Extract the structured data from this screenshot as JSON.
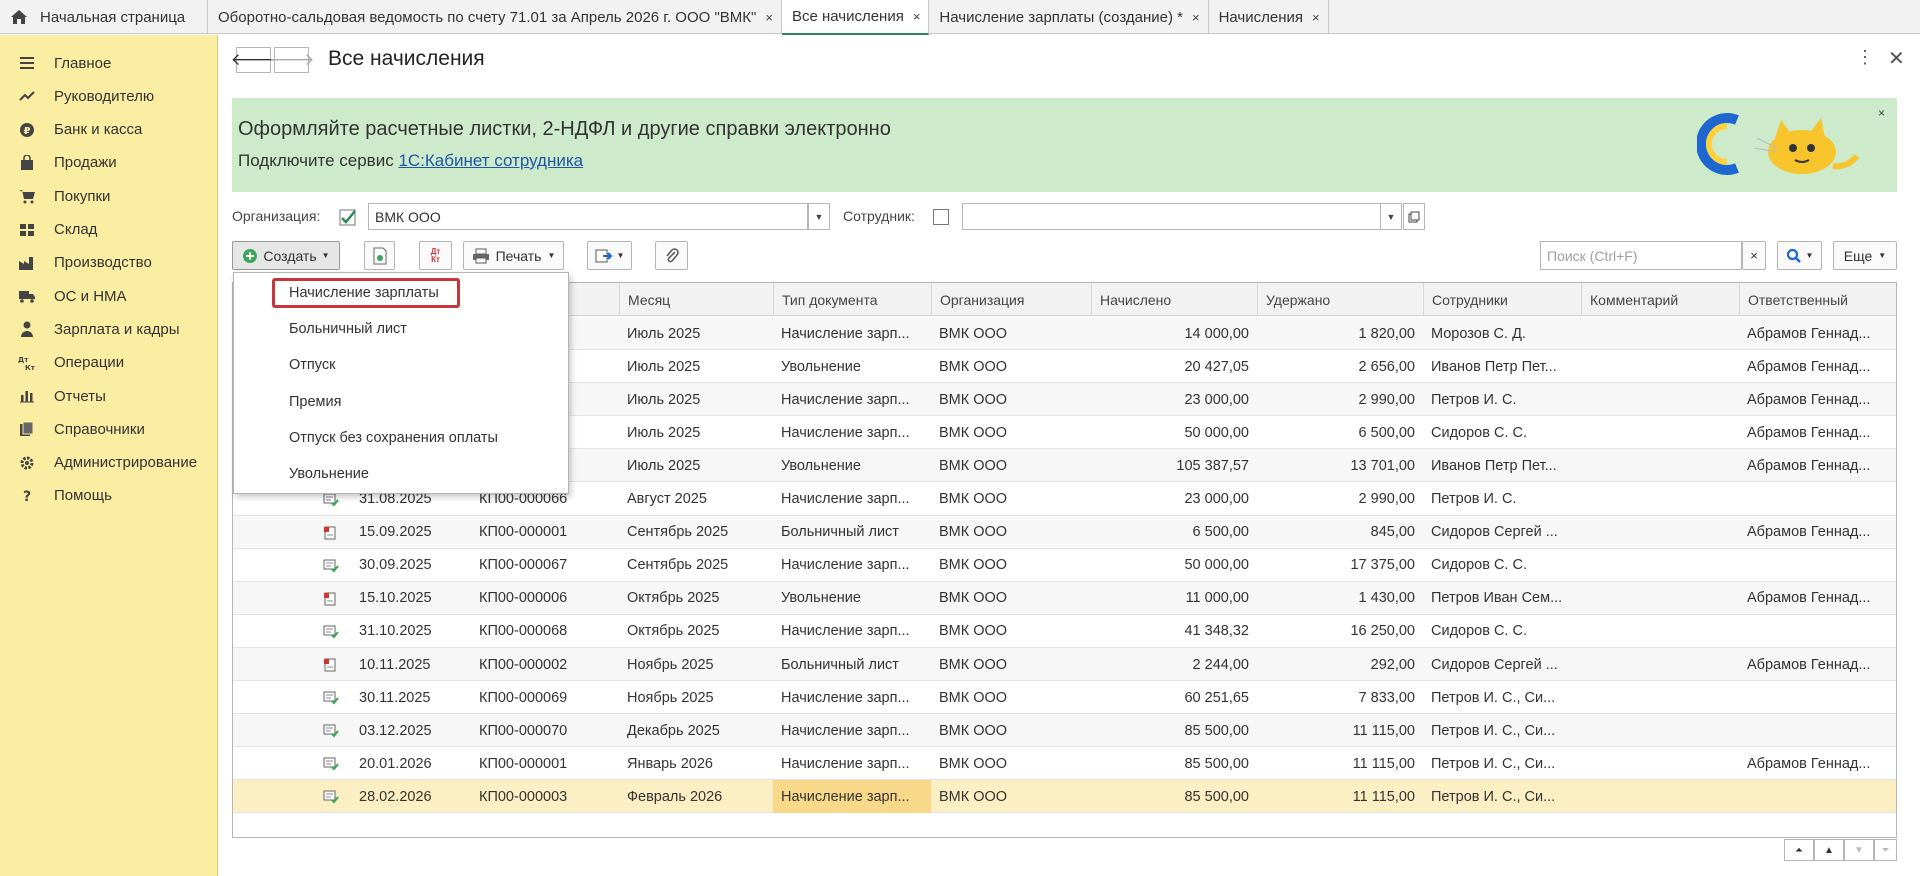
{
  "tabs": {
    "home": "Начальная страница",
    "items": [
      {
        "label": "Оборотно-сальдовая ведомость по счету 71.01 за Апрель 2026 г. ООО \"ВМК\""
      },
      {
        "label": "Все начисления"
      },
      {
        "label": "Начисление зарплаты (создание) *"
      },
      {
        "label": "Начисления"
      }
    ],
    "close_glyph": "×"
  },
  "sidebar": {
    "items": [
      {
        "label": "Главное",
        "icon": "menu-icon"
      },
      {
        "label": "Руководителю",
        "icon": "trend-icon"
      },
      {
        "label": "Банк и касса",
        "icon": "ruble-coin-icon"
      },
      {
        "label": "Продажи",
        "icon": "shopping-bag-icon"
      },
      {
        "label": "Покупки",
        "icon": "cart-icon"
      },
      {
        "label": "Склад",
        "icon": "warehouse-icon"
      },
      {
        "label": "Производство",
        "icon": "factory-icon"
      },
      {
        "label": "ОС и НМА",
        "icon": "truck-icon"
      },
      {
        "label": "Зарплата и кадры",
        "icon": "person-icon"
      },
      {
        "label": "Операции",
        "icon": "dt-kt-icon"
      },
      {
        "label": "Отчеты",
        "icon": "bar-chart-icon"
      },
      {
        "label": "Справочники",
        "icon": "books-icon"
      },
      {
        "label": "Администрирование",
        "icon": "gear-icon"
      },
      {
        "label": "Помощь",
        "icon": "question-icon"
      }
    ]
  },
  "header": {
    "title": "Все начисления",
    "back": "🡐",
    "forward": "🡒",
    "more": "⋮",
    "close": "✕"
  },
  "banner": {
    "title": "Оформляйте расчетные листки, 2-НДФЛ и другие справки электронно",
    "sub_prefix": "Подключите сервис ",
    "link": "1С:Кабинет сотрудника",
    "close": "×"
  },
  "filters": {
    "org_label": "Организация:",
    "org_value": "ВМК ООО",
    "org_checked": true,
    "employee_label": "Сотрудник:",
    "employee_value": ""
  },
  "toolbar": {
    "create": "Создать",
    "print": "Печать",
    "search_placeholder": "Поиск (Ctrl+F)",
    "search_clear": "×",
    "more": "Еще",
    "dtkt": "Дт Кт"
  },
  "create_menu": {
    "items": [
      {
        "label": "Начисление зарплаты"
      },
      {
        "label": "Больничный лист"
      },
      {
        "label": "Отпуск"
      },
      {
        "label": "Премия"
      },
      {
        "label": "Отпуск без сохранения оплаты"
      },
      {
        "label": "Увольнение"
      }
    ],
    "highlighted_index": 0
  },
  "table": {
    "columns": [
      "Месяц",
      "Тип документа",
      "Организация",
      "Начислено",
      "Удержано",
      "Сотрудники",
      "Комментарий",
      "Ответственный"
    ],
    "rows": [
      {
        "date": "",
        "number": "",
        "month": "Июль 2025",
        "type": "Начисление зарп...",
        "org": "ВМК ООО",
        "accrued": "14 000,00",
        "withheld": "1 820,00",
        "employees": "Морозов С. Д.",
        "comment": "",
        "responsible": "Абрамов Геннад...",
        "icon": "payroll-doc-icon"
      },
      {
        "date": "",
        "number": "",
        "month": "Июль 2025",
        "type": "Увольнение",
        "org": "ВМК ООО",
        "accrued": "20 427,05",
        "withheld": "2 656,00",
        "employees": "Иванов Петр Пет...",
        "comment": "",
        "responsible": "Абрамов Геннад...",
        "icon": "doc-icon"
      },
      {
        "date": "",
        "number": "",
        "month": "Июль 2025",
        "type": "Начисление зарп...",
        "org": "ВМК ООО",
        "accrued": "23 000,00",
        "withheld": "2 990,00",
        "employees": "Петров И. С.",
        "comment": "",
        "responsible": "Абрамов Геннад...",
        "icon": "payroll-doc-icon"
      },
      {
        "date": "",
        "number": "",
        "month": "Июль 2025",
        "type": "Начисление зарп...",
        "org": "ВМК ООО",
        "accrued": "50 000,00",
        "withheld": "6 500,00",
        "employees": "Сидоров С. С.",
        "comment": "",
        "responsible": "Абрамов Геннад...",
        "icon": "payroll-doc-icon"
      },
      {
        "date": "",
        "number": "",
        "month": "Июль 2025",
        "type": "Увольнение",
        "org": "ВМК ООО",
        "accrued": "105 387,57",
        "withheld": "13 701,00",
        "employees": "Иванов Петр Пет...",
        "comment": "",
        "responsible": "Абрамов Геннад...",
        "icon": "doc-icon"
      },
      {
        "date": "31.08.2025",
        "number": "КП00-000066",
        "month": "Август 2025",
        "type": "Начисление зарп...",
        "org": "ВМК ООО",
        "accrued": "23 000,00",
        "withheld": "2 990,00",
        "employees": "Петров И. С.",
        "comment": "",
        "responsible": "",
        "icon": "payroll-doc-icon"
      },
      {
        "date": "15.09.2025",
        "number": "КП00-000001",
        "month": "Сентябрь 2025",
        "type": "Больничный лист",
        "org": "ВМК ООО",
        "accrued": "6 500,00",
        "withheld": "845,00",
        "employees": "Сидоров Сергей ...",
        "comment": "",
        "responsible": "Абрамов Геннад...",
        "icon": "red-doc-icon"
      },
      {
        "date": "30.09.2025",
        "number": "КП00-000067",
        "month": "Сентябрь 2025",
        "type": "Начисление зарп...",
        "org": "ВМК ООО",
        "accrued": "50 000,00",
        "withheld": "17 375,00",
        "employees": "Сидоров С. С.",
        "comment": "",
        "responsible": "",
        "icon": "payroll-doc-icon"
      },
      {
        "date": "15.10.2025",
        "number": "КП00-000006",
        "month": "Октябрь 2025",
        "type": "Увольнение",
        "org": "ВМК ООО",
        "accrued": "11 000,00",
        "withheld": "1 430,00",
        "employees": "Петров Иван Сем...",
        "comment": "",
        "responsible": "Абрамов Геннад...",
        "icon": "red-doc-icon"
      },
      {
        "date": "31.10.2025",
        "number": "КП00-000068",
        "month": "Октябрь 2025",
        "type": "Начисление зарп...",
        "org": "ВМК ООО",
        "accrued": "41 348,32",
        "withheld": "16 250,00",
        "employees": "Сидоров С. С.",
        "comment": "",
        "responsible": "",
        "icon": "payroll-doc-icon"
      },
      {
        "date": "10.11.2025",
        "number": "КП00-000002",
        "month": "Ноябрь 2025",
        "type": "Больничный лист",
        "org": "ВМК ООО",
        "accrued": "2 244,00",
        "withheld": "292,00",
        "employees": "Сидоров Сергей ...",
        "comment": "",
        "responsible": "Абрамов Геннад...",
        "icon": "red-doc-icon"
      },
      {
        "date": "30.11.2025",
        "number": "КП00-000069",
        "month": "Ноябрь 2025",
        "type": "Начисление зарп...",
        "org": "ВМК ООО",
        "accrued": "60 251,65",
        "withheld": "7 833,00",
        "employees": "Петров И. С., Си...",
        "comment": "",
        "responsible": "",
        "icon": "payroll-doc-icon"
      },
      {
        "date": "03.12.2025",
        "number": "КП00-000070",
        "month": "Декабрь 2025",
        "type": "Начисление зарп...",
        "org": "ВМК ООО",
        "accrued": "85 500,00",
        "withheld": "11 115,00",
        "employees": "Петров И. С., Си...",
        "comment": "",
        "responsible": "",
        "icon": "payroll-doc-icon"
      },
      {
        "date": "20.01.2026",
        "number": "КП00-000001",
        "month": "Январь 2026",
        "type": "Начисление зарп...",
        "org": "ВМК ООО",
        "accrued": "85 500,00",
        "withheld": "11 115,00",
        "employees": "Петров И. С., Си...",
        "comment": "",
        "responsible": "Абрамов Геннад...",
        "icon": "payroll-doc-icon"
      },
      {
        "date": "28.02.2026",
        "number": "КП00-000003",
        "month": "Февраль 2026",
        "type": "Начисление зарп...",
        "org": "ВМК ООО",
        "accrued": "85 500,00",
        "withheld": "11 115,00",
        "employees": "Петров И. С., Си...",
        "comment": "",
        "responsible": "",
        "icon": "payroll-doc-icon",
        "selected": true
      }
    ]
  },
  "pager": {
    "first": "▲̅",
    "up": "▲",
    "down": "▼",
    "last": "▼̲"
  },
  "colors": {
    "sidebar": "#fbeda2",
    "banner": "#cdeacb",
    "active_tab": "#2e8b57",
    "selected_row": "#fcefc4",
    "highlight_border": "#c8363b",
    "link": "#1f57a6"
  }
}
